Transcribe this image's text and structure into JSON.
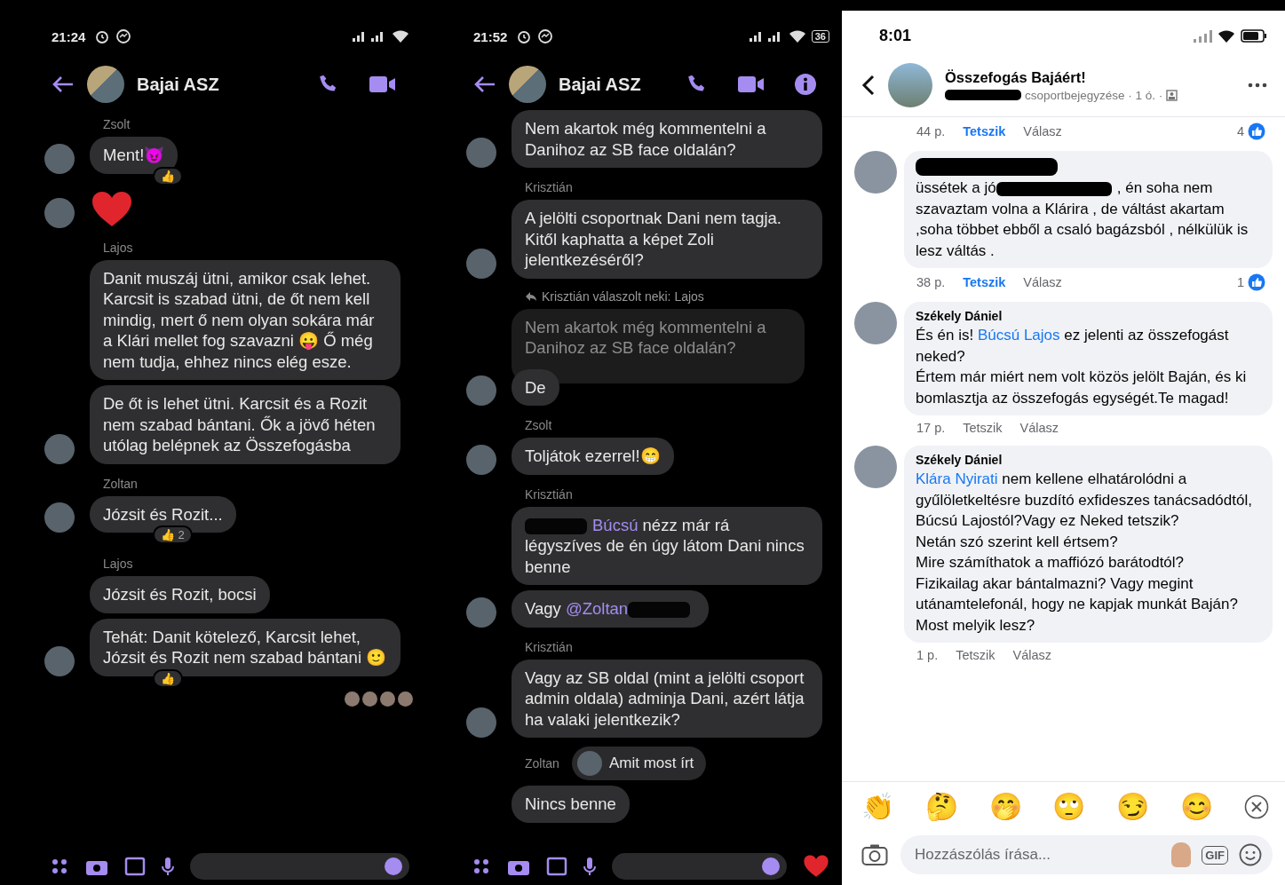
{
  "panels": [
    {
      "kind": "messenger",
      "status": {
        "time": "21:24"
      },
      "header": {
        "title": "Bajai ASZ",
        "info_button": false
      },
      "messages": [
        {
          "kind": "sender",
          "text": "Zsolt"
        },
        {
          "kind": "bubble",
          "text": "Ment!😈",
          "avatar": true,
          "reaction": "👍"
        },
        {
          "kind": "heart",
          "avatar": true
        },
        {
          "kind": "sender",
          "text": "Lajos"
        },
        {
          "kind": "bubble",
          "text": "Danit muszáj ütni, amikor csak lehet. Karcsit is szabad ütni, de őt nem kell mindig, mert ő nem olyan sokára már a Klári mellet fog szavazni 😛 Ő még nem tudja, ehhez nincs elég esze.",
          "avatar": false
        },
        {
          "kind": "bubble",
          "text": "De őt is lehet ütni. Karcsit és a Rozit nem szabad bántani. Ők a jövő héten utólag belépnek az Összefogásba",
          "avatar": true
        },
        {
          "kind": "sender",
          "text": "Zoltan"
        },
        {
          "kind": "bubble",
          "text": "Józsit és Rozit...",
          "avatar": true,
          "reaction": "👍 2"
        },
        {
          "kind": "sender",
          "text": "Lajos"
        },
        {
          "kind": "bubble",
          "text": "Józsit és Rozit, bocsi",
          "avatar": false
        },
        {
          "kind": "bubble",
          "text": "Tehát: Danit kötelező, Karcsit lehet, Józsit és Rozit nem szabad bántani 🙂",
          "avatar": true,
          "reaction": "👍"
        },
        {
          "kind": "seen"
        }
      ]
    },
    {
      "kind": "messenger",
      "status": {
        "time": "21:52",
        "battery": "36"
      },
      "header": {
        "title": "Bajai ASZ",
        "info_button": true
      },
      "messages": [
        {
          "kind": "bubble",
          "text": "Nem akartok még kommentelni a Danihoz az SB face oldalán?",
          "avatar": true
        },
        {
          "kind": "sender",
          "text": "Krisztián"
        },
        {
          "kind": "bubble",
          "text": "A jelölti csoportnak Dani nem tagja. Kitől kaphatta a képet Zoli jelentkezéséről?",
          "avatar": true
        },
        {
          "kind": "reply_note",
          "text": "Krisztián válaszolt neki: Lajos"
        },
        {
          "kind": "quoted",
          "text": "Nem akartok még kommentelni a Danihoz az SB face oldalán?"
        },
        {
          "kind": "bubble",
          "text": "De",
          "avatar": true
        },
        {
          "kind": "sender",
          "text": "Zsolt"
        },
        {
          "kind": "bubble",
          "text": "Toljátok ezerrel!😁",
          "avatar": true
        },
        {
          "kind": "sender",
          "text": "Krisztián"
        },
        {
          "kind": "bubble",
          "parts": [
            {
              "kind": "redacted"
            },
            {
              "kind": "mention",
              "text": "Búcsú"
            },
            {
              "kind": "text",
              "text": " nézz már rá légyszíves de én úgy látom Dani nincs benne"
            }
          ],
          "avatar": false
        },
        {
          "kind": "bubble",
          "parts": [
            {
              "kind": "text",
              "text": "Vagy "
            },
            {
              "kind": "mention",
              "text": "@Zoltan"
            },
            {
              "kind": "redacted"
            }
          ],
          "avatar": true
        },
        {
          "kind": "sender",
          "text": "Krisztián"
        },
        {
          "kind": "bubble",
          "text": "Vagy az SB oldal (mint a jelölti csoport admin oldala) adminja Dani, azért látja ha valaki jelentkezik?",
          "avatar": true
        },
        {
          "kind": "chip",
          "sender": "Zoltan",
          "text": "Amit most írt"
        },
        {
          "kind": "bubble",
          "text": "Nincs benne",
          "avatar": false
        }
      ]
    },
    {
      "kind": "facebook",
      "status": {
        "time": "8:01"
      },
      "header": {
        "title": "Összefogás Bajáért!",
        "subtitle": "csoportbejegyzése · 1 ó. ·"
      },
      "comments": [
        {
          "kind": "meta",
          "time": "44 p.",
          "like_label": "Tetszik",
          "liked": true,
          "reply_label": "Válasz",
          "likes": "4"
        },
        {
          "kind": "comment",
          "redacted_author": true,
          "parts": [
            {
              "kind": "text",
              "text": "üssétek a jó"
            },
            {
              "kind": "redacted"
            },
            {
              "kind": "text",
              "text": ", én soha nem szavaztam volna a Klárira , de váltást akartam ,soha többet ebből a csaló bagázsból , nélkülük is lesz váltás ."
            }
          ],
          "time": "38 p.",
          "like_label": "Tetszik",
          "liked": true,
          "reply_label": "Válasz",
          "likes": "1"
        },
        {
          "kind": "comment",
          "redacted_author": false,
          "author": "Székely Dániel",
          "parts": [
            {
              "kind": "text",
              "text": "És én is! "
            },
            {
              "kind": "mention",
              "text": "Búcsú Lajos"
            },
            {
              "kind": "text",
              "text": " ez jelenti az összefogást neked?\nÉrtem már miért nem volt közös jelölt Baján, és ki bomlasztja  az összefogás egységét.Te magad!"
            }
          ],
          "time": "17 p.",
          "like_label": "Tetszik",
          "liked": false,
          "reply_label": "Válasz"
        },
        {
          "kind": "comment",
          "redacted_author": false,
          "author": "Székely Dániel",
          "parts": [
            {
              "kind": "mention",
              "text": "Klára Nyirati"
            },
            {
              "kind": "text",
              "text": " nem kellene elhatárolódni a gyűlöletkeltésre buzdító exfideszes tanácsadódtól, Búcsú Lajostól?Vagy ez Neked tetszik?\nNetán szó szerint kell értsem?\nMire számíthatok a maffiózó barátodtól?\nFizikailag akar bántalmazni? Vagy megint utánamtelefonál, hogy ne kapjak munkát Baján?\nMost melyik lesz?"
            }
          ],
          "time": "1 p.",
          "like_label": "Tetszik",
          "liked": false,
          "reply_label": "Válasz"
        }
      ],
      "quick_reactions": [
        "👏",
        "🤔",
        "🤭",
        "🙄",
        "😏",
        "😊"
      ],
      "composer": {
        "placeholder": "Hozzászólás írása...",
        "gif_label": "GIF"
      }
    }
  ]
}
